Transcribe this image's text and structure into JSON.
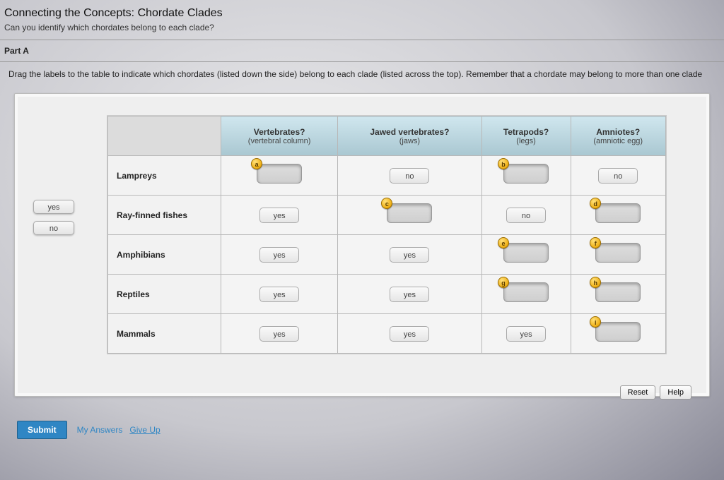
{
  "header": {
    "title": "Connecting the Concepts: Chordate Clades",
    "subtitle": "Can you identify which chordates belong to each clade?"
  },
  "part": {
    "label": "Part A",
    "instructions_prefix": "Drag the labels to the table to indicate which chordates (listed down the side) belong to each clade (listed across the top). Remember that a chordate may belong to more than one clade"
  },
  "dragbank": {
    "items": [
      "yes",
      "no"
    ]
  },
  "columns": [
    {
      "title": "Vertebrates?",
      "sub": "(vertebral column)"
    },
    {
      "title": "Jawed vertebrates?",
      "sub": "(jaws)"
    },
    {
      "title": "Tetrapods?",
      "sub": "(legs)"
    },
    {
      "title": "Amniotes?",
      "sub": "(amniotic egg)"
    }
  ],
  "rows": [
    {
      "label": "Lampreys",
      "cells": [
        {
          "type": "target",
          "badge": "a"
        },
        {
          "type": "answer",
          "value": "no"
        },
        {
          "type": "target",
          "badge": "b"
        },
        {
          "type": "answer",
          "value": "no"
        }
      ]
    },
    {
      "label": "Ray-finned fishes",
      "cells": [
        {
          "type": "answer",
          "value": "yes"
        },
        {
          "type": "target",
          "badge": "c"
        },
        {
          "type": "answer",
          "value": "no"
        },
        {
          "type": "target",
          "badge": "d"
        }
      ]
    },
    {
      "label": "Amphibians",
      "cells": [
        {
          "type": "answer",
          "value": "yes"
        },
        {
          "type": "answer",
          "value": "yes"
        },
        {
          "type": "target",
          "badge": "e"
        },
        {
          "type": "target",
          "badge": "f"
        }
      ]
    },
    {
      "label": "Reptiles",
      "cells": [
        {
          "type": "answer",
          "value": "yes"
        },
        {
          "type": "answer",
          "value": "yes"
        },
        {
          "type": "target",
          "badge": "g"
        },
        {
          "type": "target",
          "badge": "h"
        }
      ]
    },
    {
      "label": "Mammals",
      "cells": [
        {
          "type": "answer",
          "value": "yes"
        },
        {
          "type": "answer",
          "value": "yes"
        },
        {
          "type": "answer",
          "value": "yes"
        },
        {
          "type": "target",
          "badge": "i"
        }
      ]
    }
  ],
  "controls": {
    "reset": "Reset",
    "help": "Help",
    "submit": "Submit",
    "my_answers": "My Answers",
    "give_up": "Give Up"
  }
}
